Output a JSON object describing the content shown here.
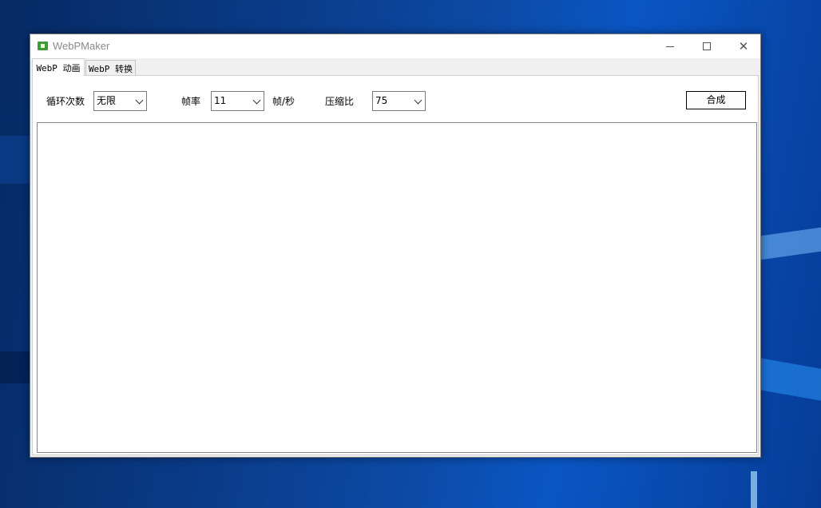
{
  "window": {
    "title": "WebPMaker",
    "controls": {
      "minimize": "minimize-icon",
      "maximize": "maximize-icon",
      "close": "close-icon"
    }
  },
  "tabs": [
    {
      "label": "WebP 动画",
      "active": true
    },
    {
      "label": "WebP 转换",
      "active": false
    }
  ],
  "settings": {
    "loop_label": "循环次数",
    "loop_value": "无限",
    "fps_label": "帧率",
    "fps_value": "11",
    "fps_unit": "帧/秒",
    "quality_label": "压缩比",
    "quality_value": "75"
  },
  "actions": {
    "compose_label": "合成"
  },
  "colors": {
    "app_icon": "#3f9c35",
    "desktop": "#0c4aa6",
    "window_bg": "#f0f0f0"
  }
}
